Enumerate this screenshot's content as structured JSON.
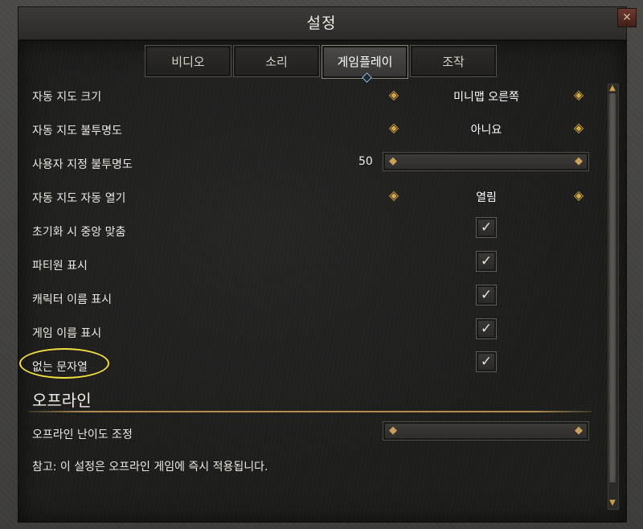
{
  "window": {
    "title": "설정",
    "close_glyph": "✕"
  },
  "tabs": [
    {
      "label": "비디오",
      "active": false
    },
    {
      "label": "소리",
      "active": false
    },
    {
      "label": "게임플레이",
      "active": true
    },
    {
      "label": "조작",
      "active": false
    }
  ],
  "settings": {
    "minimap_size": {
      "label": "자동 지도 크기",
      "value": "미니맵 오른쪽"
    },
    "map_opacity": {
      "label": "자동 지도 불투명도",
      "value": "아니요"
    },
    "custom_opacity": {
      "label": "사용자 지정 불투명도",
      "value": "50"
    },
    "auto_open": {
      "label": "자동 지도 자동 열기",
      "value": "열림"
    },
    "center_on_reset": {
      "label": "초기화 시 중앙 맞춤",
      "checked": true
    },
    "show_party": {
      "label": "파티원 표시",
      "checked": true
    },
    "show_char_name": {
      "label": "캐릭터 이름 표시",
      "checked": true
    },
    "show_game_name": {
      "label": "게임 이름 표시",
      "checked": true
    },
    "missing_string": {
      "label": "없는 문자열",
      "checked": true
    }
  },
  "offline": {
    "section_title": "오프라인",
    "difficulty_label": "오프라인 난이도 조정",
    "note": "참고: 이 설정은 오프라인 게임에 즉시 적용됩니다."
  },
  "icons": {
    "arrow_left": "◈",
    "arrow_right": "◈",
    "check": "✓",
    "scroll_up": "▲",
    "scroll_down": "▼",
    "slider_cap": "◆"
  },
  "colors": {
    "accent_gold": "#d9a840",
    "highlight_yellow": "#f0e13a"
  }
}
